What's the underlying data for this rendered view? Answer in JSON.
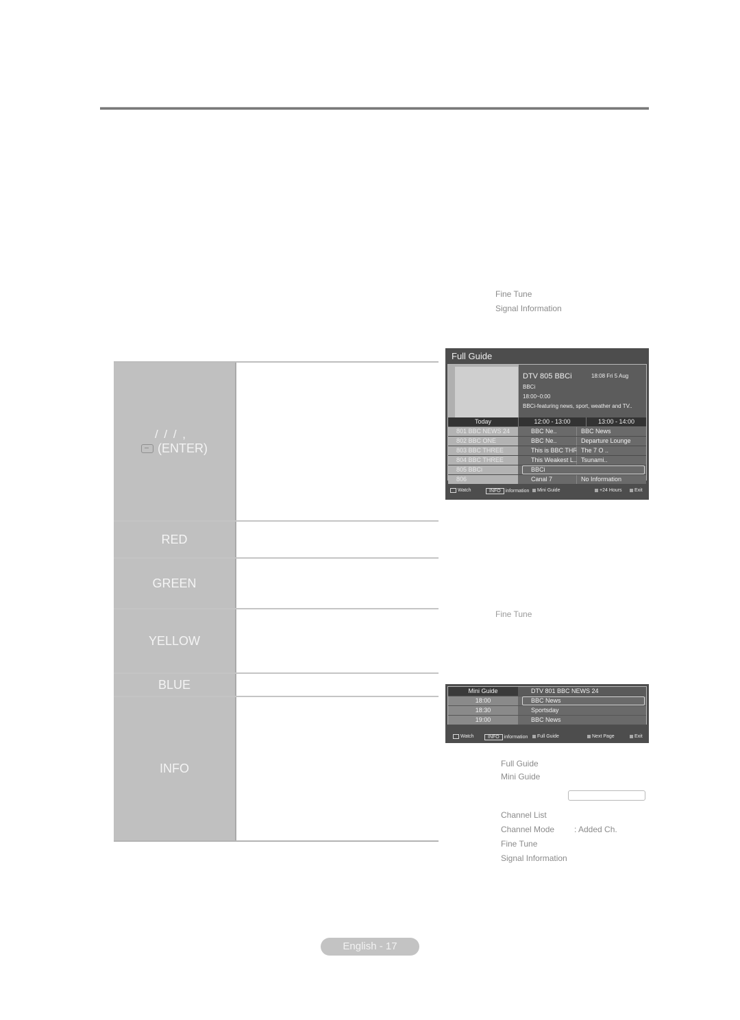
{
  "side_menu_top": {
    "items": [
      "Fine Tune",
      "Signal Information"
    ]
  },
  "key_table": {
    "rows": [
      {
        "key_line1": "/ / / ,",
        "key_line2": "(ENTER)",
        "icon": "enter-icon"
      },
      {
        "key": "RED"
      },
      {
        "key": "GREEN"
      },
      {
        "key": "YELLOW"
      },
      {
        "key": "BLUE"
      },
      {
        "key": "INFO"
      }
    ]
  },
  "full_guide": {
    "title": "Full Guide",
    "channel": "DTV 805 BBCi",
    "datetime": "18:08 Fri 5 Aug",
    "program": "BBCi",
    "time_range": "18:00~0:00",
    "description": "BBCi-featuring news, sport, weather and TV..",
    "columns": [
      "Today",
      "12:00 - 13:00",
      "13:00 - 14:00"
    ],
    "rows": [
      {
        "channel": "801 BBC NEWS 24",
        "slot1": "BBC Ne..",
        "slot2": "BBC News"
      },
      {
        "channel": "802 BBC ONE",
        "slot1": "BBC Ne..",
        "slot2": "Departure Lounge"
      },
      {
        "channel": "803 BBC THREE",
        "slot1": "This is BBC THREE",
        "slot2": "The 7 O .."
      },
      {
        "channel": "804 BBC THREE",
        "slot1": "This Weakest L..",
        "slot2": "Tsunami.."
      },
      {
        "channel": "805 BBCi",
        "wide": "BBCi",
        "selected": true
      },
      {
        "channel": "806",
        "slot1": "Canal 7",
        "slot2": "No Information"
      }
    ],
    "footer": {
      "watch": "Watch",
      "info_key": "INFO",
      "information": "information",
      "mini_guide": "Mini Guide",
      "plus24": "+24 Hours",
      "exit": "Exit"
    }
  },
  "side_menu_mid": {
    "item": "Fine Tune"
  },
  "mini_guide": {
    "title": "Mini Guide",
    "channel": "DTV 801 BBC NEWS 24",
    "rows": [
      {
        "time": "18:00",
        "program": "BBC News",
        "selected": true
      },
      {
        "time": "18:30",
        "program": "Sportsday"
      },
      {
        "time": "19:00",
        "program": "BBC News"
      }
    ],
    "footer": {
      "watch": "Watch",
      "info_key": "INFO",
      "information": "information",
      "full_guide": "Full Guide",
      "next_page": "Next Page",
      "exit": "Exit"
    }
  },
  "side_menu_bottom": {
    "items": [
      "Full Guide",
      "Mini Guide"
    ],
    "items2": [
      "Channel List",
      "Channel Mode",
      "Fine Tune",
      "Signal Information"
    ],
    "channel_mode_value": ": Added Ch."
  },
  "page": {
    "label": "English - 17"
  }
}
